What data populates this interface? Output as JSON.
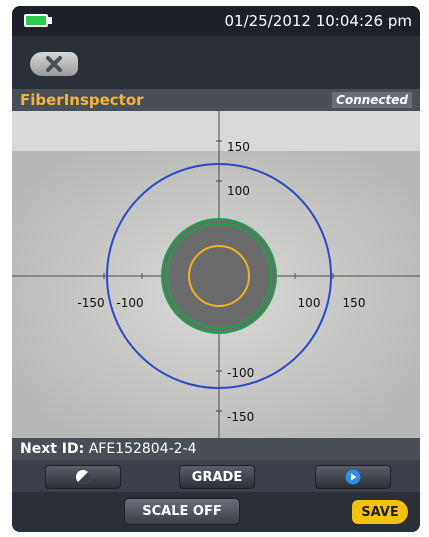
{
  "status_bar": {
    "datetime": "01/25/2012 10:04:26 pm"
  },
  "icons": {
    "battery": "battery-icon",
    "close": "close-x-icon",
    "contrast": "half-circle-icon",
    "play": "play-icon"
  },
  "header": {
    "title": "FiberInspector",
    "connection_status": "Connected"
  },
  "scope": {
    "x_ticks": {
      "neg150": "-150",
      "neg100": "-100",
      "pos100": "100",
      "pos150": "150"
    },
    "y_ticks": {
      "pos150": "150",
      "pos100": "100",
      "neg100": "-100",
      "neg150": "-150"
    },
    "ring_colors": {
      "outer": "#2b49c7",
      "green": "#1aa34a",
      "inner": "#f2b21f"
    }
  },
  "next_id": {
    "label": "Next ID:",
    "value": "AFE152804-2-4"
  },
  "buttons": {
    "grade": "GRADE",
    "scale": "SCALE OFF",
    "save": "SAVE"
  },
  "colors": {
    "accent": "#f2b43a",
    "save": "#f4c20d",
    "battery": "#2ec84a"
  }
}
